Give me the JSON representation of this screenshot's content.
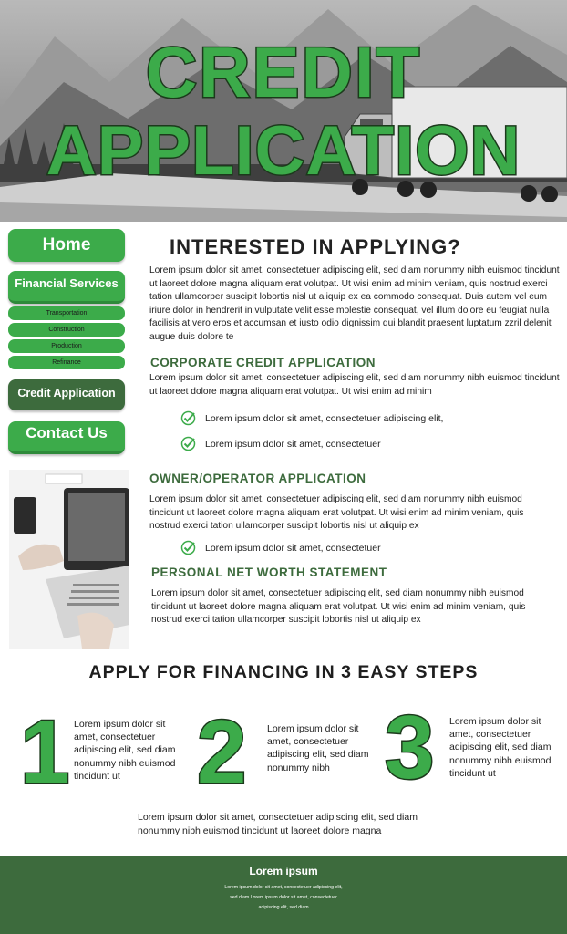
{
  "hero": {
    "title_line1": "CREDIT",
    "title_line2": "APPLICATION"
  },
  "nav": {
    "home": "Home",
    "financial_services": "Financial Services",
    "sub_items": [
      "Transportation",
      "Construction",
      "Production",
      "Refinance"
    ],
    "credit_application": "Credit Application",
    "contact_us": "Contact Us"
  },
  "main": {
    "heading": "INTERESTED IN APPLYING?",
    "intro": "Lorem ipsum dolor sit amet, consectetuer adipiscing elit, sed diam nonummy nibh euismod tincidunt ut laoreet dolore magna aliquam erat volutpat. Ut wisi enim ad minim veniam, quis nostrud exerci tation ullamcorper suscipit lobortis nisl ut aliquip ex ea commodo consequat. Duis autem vel eum iriure dolor in hendrerit in vulputate velit esse molestie consequat, vel illum dolore eu feugiat nulla facilisis at vero eros et accumsan et iusto odio dignissim qui blandit praesent luptatum zzril delenit augue duis dolore te",
    "corporate": {
      "heading": "CORPORATE CREDIT APPLICATION",
      "text": "Lorem ipsum dolor sit amet, consectetuer adipiscing elit, sed diam nonummy nibh euismod tincidunt ut laoreet dolore magna aliquam erat volutpat. Ut wisi enim ad minim",
      "checks": [
        "Lorem ipsum dolor sit amet, consectetuer adipiscing elit,",
        "Lorem ipsum dolor sit amet, consectetuer"
      ]
    },
    "owner": {
      "heading": "OWNER/OPERATOR APPLICATION",
      "text": "Lorem ipsum dolor sit amet, consectetuer adipiscing elit, sed diam nonummy nibh euismod tincidunt ut laoreet dolore magna aliquam erat volutpat. Ut wisi enim ad minim veniam, quis nostrud exerci tation ullamcorper suscipit lobortis nisl ut aliquip ex",
      "checks": [
        "Lorem ipsum dolor sit amet, consectetuer"
      ]
    },
    "networth": {
      "heading": "PERSONAL NET WORTH STATEMENT",
      "text": "Lorem ipsum dolor sit amet, consectetuer adipiscing elit, sed diam nonummy nibh euismod tincidunt ut laoreet dolore magna aliquam erat volutpat. Ut wisi enim ad minim veniam, quis nostrud exerci tation ullamcorper suscipit lobortis nisl ut aliquip ex"
    }
  },
  "steps": {
    "heading": "APPLY FOR FINANCING IN 3 EASY STEPS",
    "items": [
      {
        "num": "1",
        "text": "Lorem ipsum dolor sit amet, consectetuer adipiscing elit, sed diam nonummy nibh euismod tincidunt ut"
      },
      {
        "num": "2",
        "text": "Lorem ipsum dolor sit amet, consectetuer adipiscing elit, sed diam nonummy nibh"
      },
      {
        "num": "3",
        "text": "Lorem ipsum dolor sit amet, consectetuer adipiscing elit, sed diam nonummy nibh euismod tincidunt ut"
      }
    ],
    "bottom": "Lorem ipsum dolor sit amet, consectetuer adipiscing elit, sed diam nonummy nibh euismod tincidunt ut laoreet dolore magna"
  },
  "footer": {
    "title": "Lorem ipsum",
    "body": "Lorem ipsum dolor sit amet, consectetuer adipiscing elit, sed diam Lorem ipsum dolor sit amet, consectetuer adipiscing elit, sed diam"
  },
  "colors": {
    "green": "#3cab4a",
    "dark_green": "#3d6b3d",
    "outline": "#1c3a1c"
  },
  "icons": [
    "check-icon"
  ]
}
